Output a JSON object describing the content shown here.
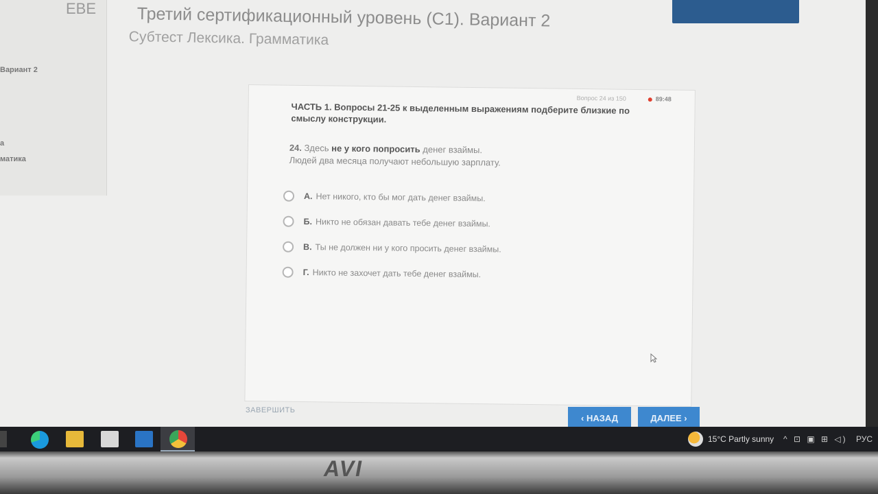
{
  "header": {
    "top_icon": "EBE",
    "title": "Третий сертификационный уровень (С1). Вариант 2",
    "subtitle": "Субтест Лексика. Грамматика"
  },
  "sidebar": {
    "item1": "Вариант 2",
    "item2": "а",
    "item3": "матика"
  },
  "card": {
    "meta": "Вопрос 24 из 150",
    "timer": "89:48",
    "instruction": "ЧАСТЬ 1. Вопросы 21-25 к выделенным выражениям подберите близкие по смыслу конструкции.",
    "question": {
      "number": "24.",
      "prefix": "Здесь",
      "bold": "не у кого попросить",
      "suffix": "денег взаймы.",
      "line2": "Людей два месяца получают небольшую зарплату."
    },
    "options": [
      {
        "letter": "А.",
        "text": "Нет никого, кто бы мог дать денег взаймы."
      },
      {
        "letter": "Б.",
        "text": "Никто не обязан давать тебе денег взаймы."
      },
      {
        "letter": "В.",
        "text": "Ты не должен ни у кого просить денег взаймы."
      },
      {
        "letter": "Г.",
        "text": "Никто не захочет дать тебе денег взаймы."
      }
    ]
  },
  "footer": {
    "finish": "ЗАВЕРШИТЬ",
    "back": "‹ НАЗАД",
    "next": "ДАЛЕЕ ›"
  },
  "taskbar": {
    "weather": "15°C  Partly sunny",
    "tray": "^ ⊡ ▣ ⊞ ◁)",
    "lang": "РУС"
  },
  "monitor": {
    "brand": "AVI"
  },
  "colors": {
    "accent": "#3e88cf",
    "header_strip": "#2c5c8f",
    "timer_dot": "#e04030"
  }
}
